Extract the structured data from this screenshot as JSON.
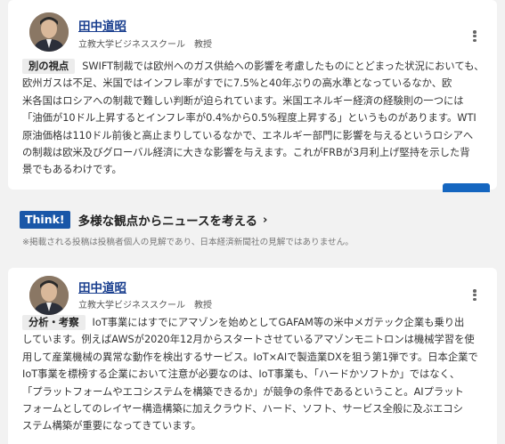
{
  "posts": [
    {
      "author_name": "田中道昭",
      "author_title": "立教大学ビジネススクール　教授",
      "tag": "別の視点",
      "lines": [
        "SWIFT制裁では欧州へのガス供給への影響を考慮したものにとどまった状況においても、欧州ガスは不足、米国ではインフレ率がすでに7.5%と40年ぶりの高水準となっているなか、欧",
        "米各国はロシアへの制裁で難しい判断が迫られています。米国エネルギー経済の経験則の一つには",
        "「油価が10ドル上昇するとインフレ率が0.4%から0.5%程度上昇する」というものがあります。WTI",
        "原油価格は110ドル前後と高止まりしているなかで、エネルギー部門に影響を与えるというロシアへ",
        "の制裁は欧米及びグローバル経済に大きな影響を与えます。これがFRBが3月利上げ堅持を示した背",
        "景でもあるわけです。"
      ]
    },
    {
      "author_name": "田中道昭",
      "author_title": "立教大学ビジネススクール　教授",
      "tag": "分析・考察",
      "lines": [
        "IoT事業にはすでにアマゾンを始めとしてGAFAM等の米中メガテック企業も乗り出",
        "しています。例えばAWSが2020年12月からスタートさせているアマゾンモニトロンは機械学習を使",
        "用して産業機械の異常な動作を検出するサービス。IoT×AIで製造業DXを狙う第1弾です。日本企業で",
        "IoT事業を標榜する企業において注意が必要なのは、IoT事業も、「ハードかソフトか」ではなく、",
        "「プラットフォームやエコシステムを構築できるか」が競争の条件であるということ。AIプラット",
        "フォームとしてのレイヤー構造構築に加えクラウド、ハード、ソフト、サービス全般に及ぶエコシ",
        "ステム構築が重要になってきています。"
      ]
    }
  ],
  "think": {
    "badge": "Think!",
    "title": "多様な観点からニュースを考える",
    "chevron": "›",
    "disclaimer": "※掲載される投稿は投稿者個人の見解であり、日本経済新聞社の見解ではありません。"
  },
  "colors": {
    "accent": "#1a57a8",
    "name_link": "#1a3f8f",
    "button": "#1566c0"
  }
}
